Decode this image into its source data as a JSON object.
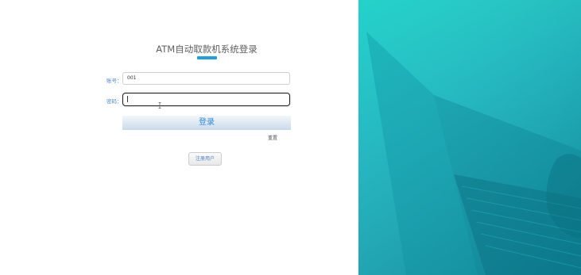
{
  "login": {
    "title": "ATM自动取款机系统登录",
    "account_label": "账号：",
    "account_value": "001",
    "password_label": "密码：",
    "password_value": "",
    "login_label": "登录",
    "reset_label": "重置",
    "register_label": "注册用户"
  },
  "colors": {
    "accent": "#1ba1e2",
    "label": "#4a8ad0",
    "panel_teal": "#13b5c0"
  },
  "icons": {
    "text_cursor": "I-beam"
  }
}
